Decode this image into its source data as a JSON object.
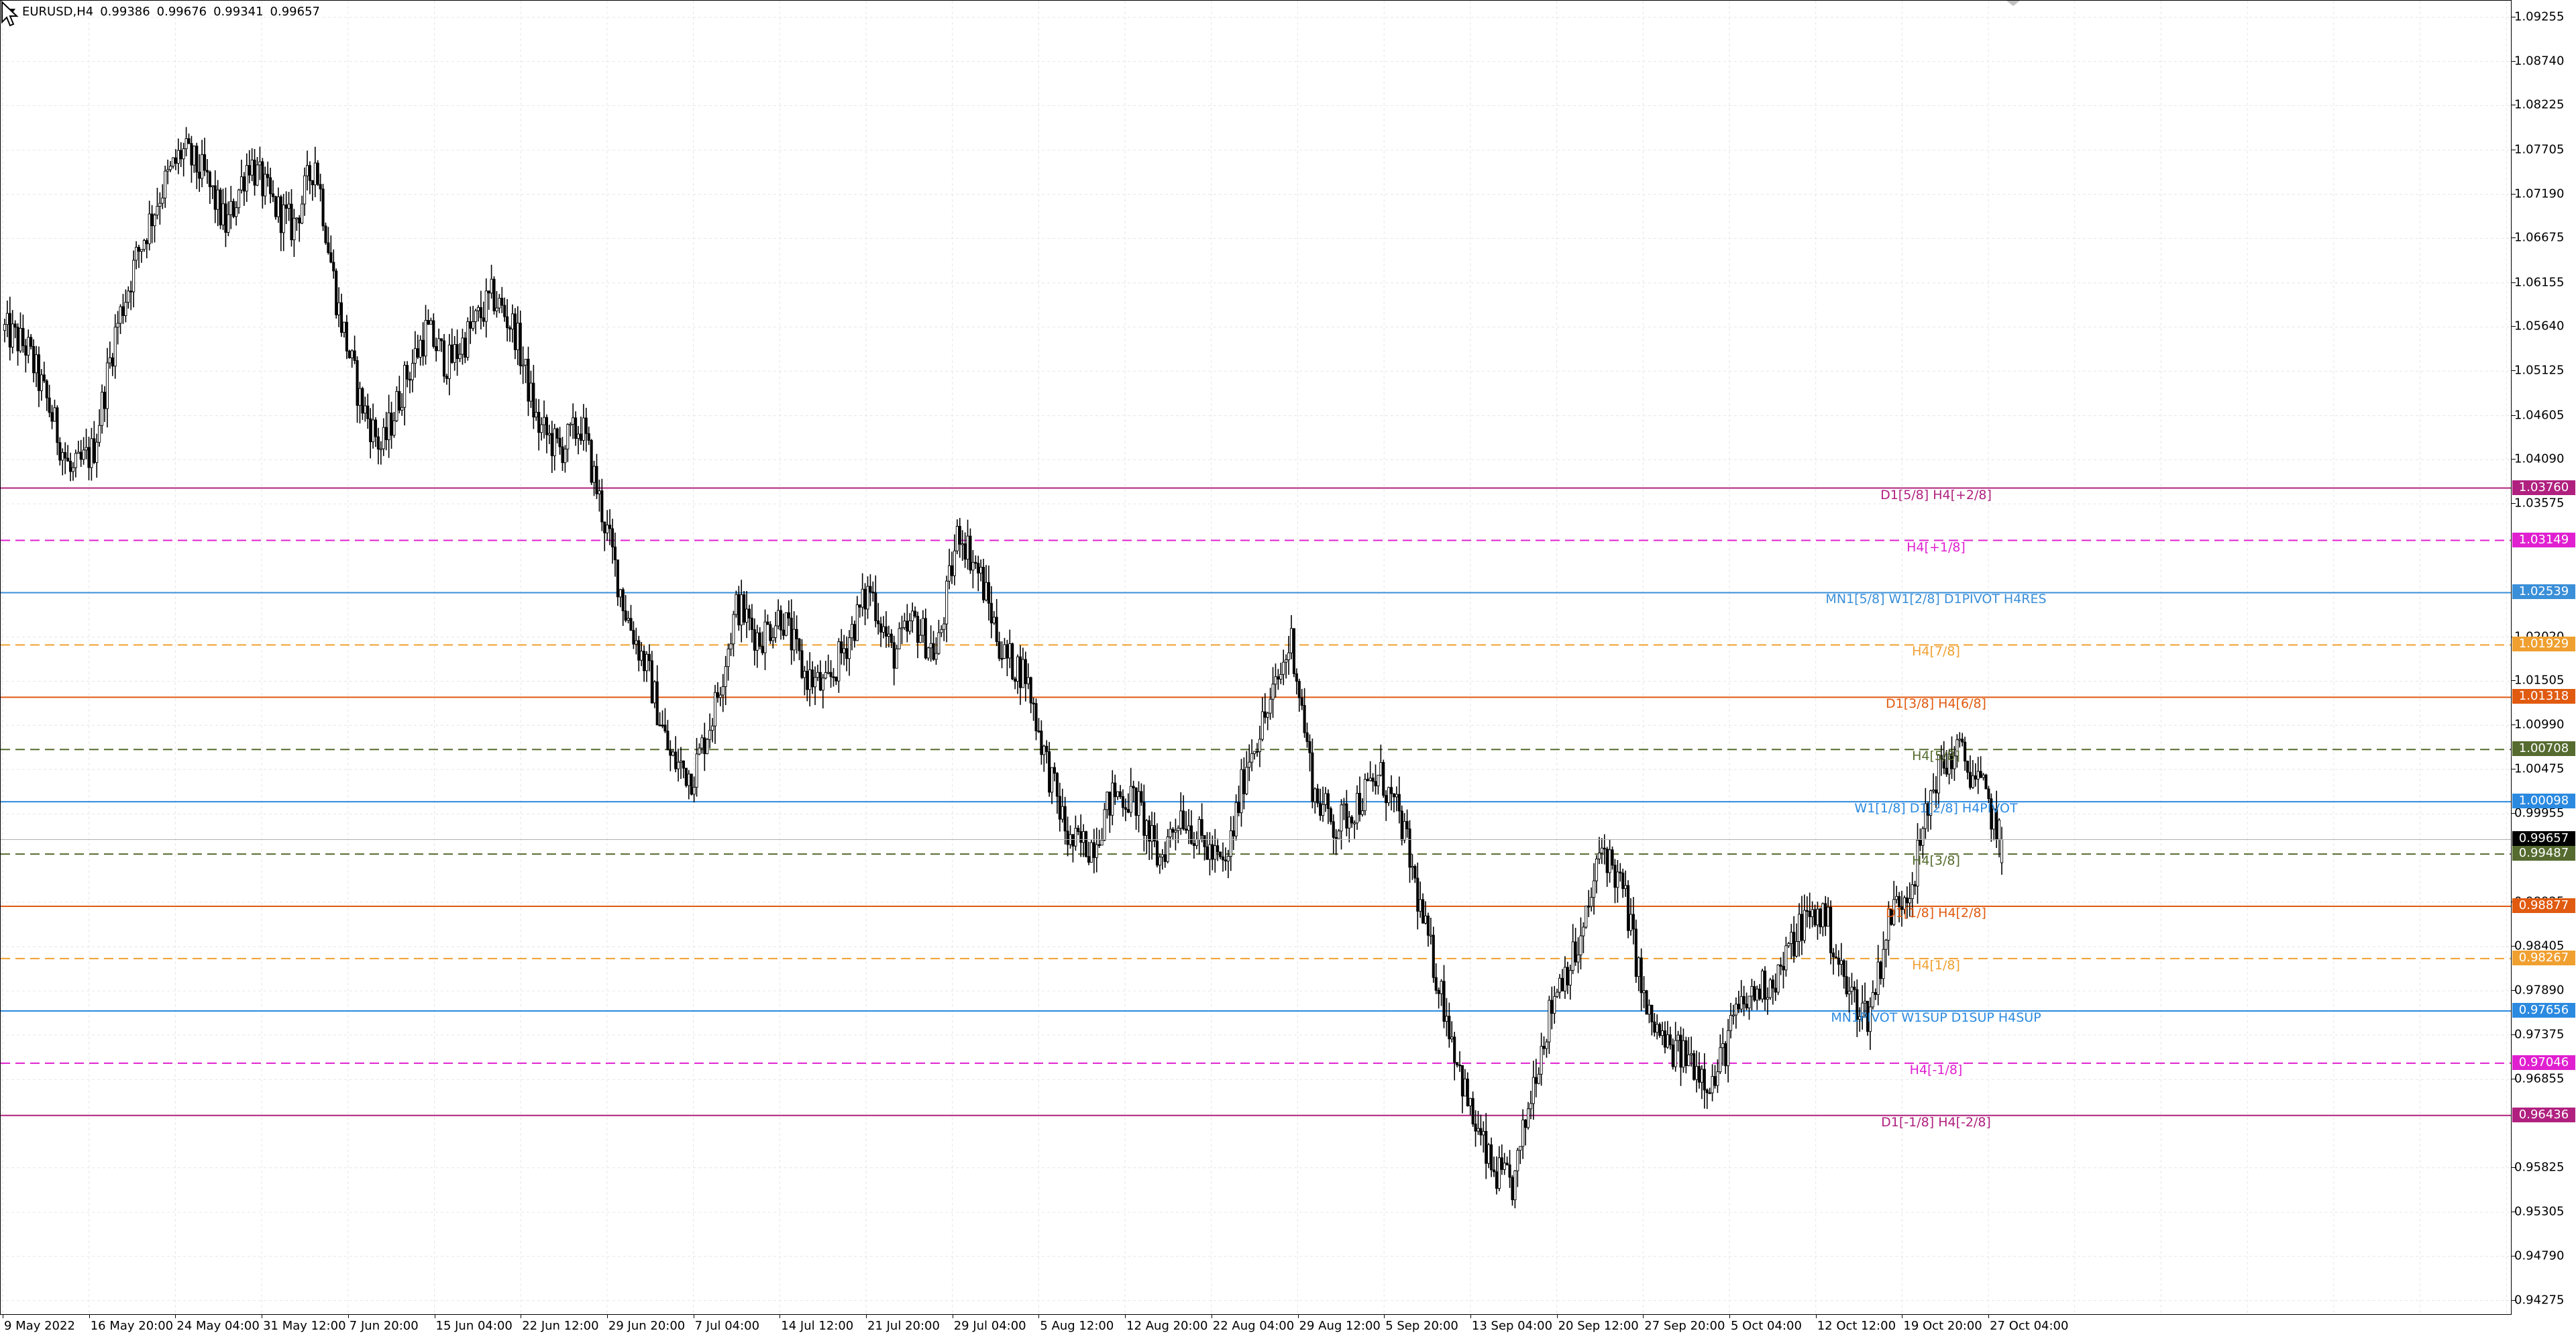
{
  "header": {
    "symbol": "EURUSD,H4",
    "open": "0.99386",
    "high": "0.99676",
    "low": "0.99341",
    "close": "0.99657"
  },
  "price_axis": {
    "ticks": [
      "1.09255",
      "1.08740",
      "1.08225",
      "1.07705",
      "1.07190",
      "1.06675",
      "1.06155",
      "1.05640",
      "1.05125",
      "1.04605",
      "1.04090",
      "1.03575",
      "1.02020",
      "1.01505",
      "1.00990",
      "1.00475",
      "0.99955",
      "0.98925",
      "0.98405",
      "0.97890",
      "0.97375",
      "0.96855",
      "0.95825",
      "0.95305",
      "0.94790",
      "0.94275"
    ]
  },
  "time_axis": {
    "labels": [
      "9 May 2022",
      "16 May 20:00",
      "24 May 04:00",
      "31 May 12:00",
      "7 Jun 20:00",
      "15 Jun 04:00",
      "22 Jun 12:00",
      "29 Jun 20:00",
      "7 Jul 04:00",
      "14 Jul 12:00",
      "21 Jul 20:00",
      "29 Jul 04:00",
      "5 Aug 12:00",
      "12 Aug 20:00",
      "22 Aug 04:00",
      "29 Aug 12:00",
      "5 Sep 20:00",
      "13 Sep 04:00",
      "20 Sep 12:00",
      "27 Sep 20:00",
      "5 Oct 04:00",
      "12 Oct 12:00",
      "19 Oct 20:00",
      "27 Oct 04:00"
    ]
  },
  "levels": [
    {
      "price": "1.03760",
      "label": "D1[5/8] H4[+2/8]",
      "color": "#b0207f",
      "style": "solid"
    },
    {
      "price": "1.03149",
      "label": "H4[+1/8]",
      "color": "#e020d0",
      "style": "dashed"
    },
    {
      "price": "1.02539",
      "label": "MN1[5/8] W1[2/8] D1PIVOT H4RES",
      "color": "#3a8fd8",
      "style": "solid"
    },
    {
      "price": "1.01929",
      "label": "H4[7/8]",
      "color": "#f0a030",
      "style": "dashed"
    },
    {
      "price": "1.01318",
      "label": "D1[3/8] H4[6/8]",
      "color": "#e05a10",
      "style": "solid"
    },
    {
      "price": "1.00708",
      "label": "H4[5/8]",
      "color": "#556b2f",
      "style": "dashed"
    },
    {
      "price": "1.00098",
      "label": "W1[1/8] D1[2/8] H4PIVOT",
      "color": "#2b8ae0",
      "style": "solid"
    },
    {
      "price": "0.99487",
      "label": "H4[3/8]",
      "color": "#556b2f",
      "style": "dashed"
    },
    {
      "price": "0.98877",
      "label": "D1[1/8] H4[2/8]",
      "color": "#e05a10",
      "style": "solid"
    },
    {
      "price": "0.98267",
      "label": "H4[1/8]",
      "color": "#f0a030",
      "style": "dashed"
    },
    {
      "price": "0.97656",
      "label": "MN1PIVOT W1SUP D1SUP H4SUP",
      "color": "#2b8ae0",
      "style": "solid"
    },
    {
      "price": "0.97046",
      "label": "H4[-1/8]",
      "color": "#e020d0",
      "style": "dashed"
    },
    {
      "price": "0.96436",
      "label": "D1[-1/8] H4[-2/8]",
      "color": "#b0207f",
      "style": "solid"
    }
  ],
  "current_price": "0.99657",
  "chart_data": {
    "type": "candlestick",
    "title": "EURUSD,H4",
    "ylim": [
      0.941,
      1.0945
    ],
    "x_labels": [
      "9 May 2022",
      "16 May 20:00",
      "24 May 04:00",
      "31 May 12:00",
      "7 Jun 20:00",
      "15 Jun 04:00",
      "22 Jun 12:00",
      "29 Jun 20:00",
      "7 Jul 04:00",
      "14 Jul 12:00",
      "21 Jul 20:00",
      "29 Jul 04:00",
      "5 Aug 12:00",
      "12 Aug 20:00",
      "22 Aug 04:00",
      "29 Aug 12:00",
      "5 Sep 20:00",
      "13 Sep 04:00",
      "20 Sep 12:00",
      "27 Sep 20:00",
      "5 Oct 04:00",
      "12 Oct 12:00",
      "19 Oct 20:00",
      "27 Oct 04:00"
    ],
    "close_path": [
      1.056,
      1.054,
      1.047,
      1.039,
      1.042,
      1.056,
      1.065,
      1.072,
      1.077,
      1.074,
      1.068,
      1.076,
      1.071,
      1.068,
      1.076,
      1.059,
      1.048,
      1.042,
      1.05,
      1.056,
      1.052,
      1.056,
      1.06,
      1.056,
      1.045,
      1.042,
      1.045,
      1.034,
      1.023,
      1.016,
      1.006,
      1.004,
      1.012,
      1.024,
      1.02,
      1.023,
      1.016,
      1.014,
      1.02,
      1.026,
      1.018,
      1.022,
      1.018,
      1.033,
      1.027,
      1.018,
      1.016,
      1.005,
      0.996,
      0.996,
      1.002,
      1.001,
      0.994,
      1.0,
      0.996,
      0.993,
      1.006,
      1.012,
      1.02,
      1.002,
      0.998,
      1.001,
      1.004,
      0.998,
      0.986,
      0.976,
      0.965,
      0.958,
      0.956,
      0.97,
      0.98,
      0.984,
      0.996,
      0.99,
      0.976,
      0.972,
      0.971,
      0.968,
      0.976,
      0.979,
      0.981,
      0.987,
      0.988,
      0.979,
      0.976,
      0.988,
      0.992,
      1.004,
      1.007,
      1.003,
      0.9966
    ],
    "y_ticks": [
      1.09255,
      1.0874,
      1.08225,
      1.07705,
      1.0719,
      1.06675,
      1.06155,
      1.0564,
      1.05125,
      1.04605,
      1.0409,
      1.03575,
      1.0202,
      1.01505,
      1.0099,
      1.00475,
      0.99955,
      0.98925,
      0.98405,
      0.9789,
      0.97375,
      0.96855,
      0.95825,
      0.95305,
      0.9479,
      0.94275
    ]
  }
}
